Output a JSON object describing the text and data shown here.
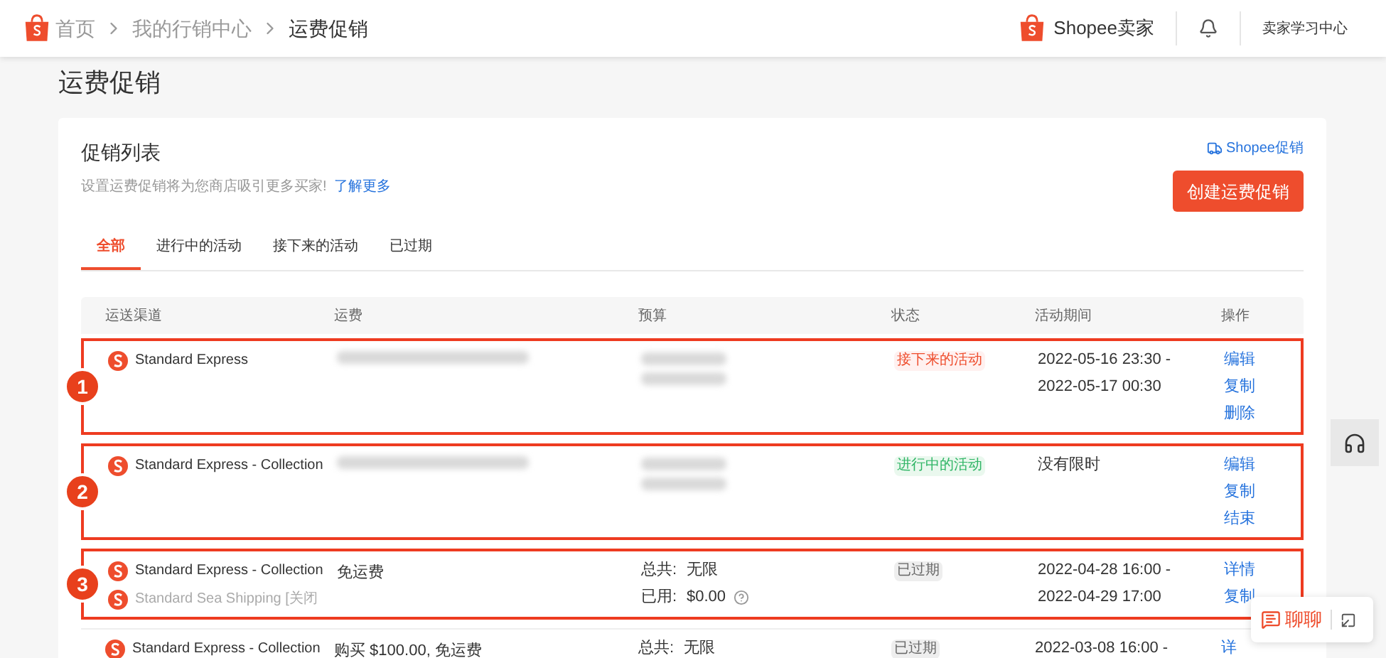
{
  "breadcrumb": [
    {
      "label": "首页",
      "current": false
    },
    {
      "label": "我的行销中心",
      "current": false
    },
    {
      "label": "运费促销",
      "current": true
    }
  ],
  "header": {
    "brand": "Shopee卖家",
    "learning_center": "卖家学习中心"
  },
  "page_title": "运费促销",
  "card": {
    "title": "促销列表",
    "description": "设置运费促销将为您商店吸引更多买家!",
    "learn_more": "了解更多",
    "shopee_link": "Shopee促销",
    "create_button": "创建运费促销"
  },
  "tabs": [
    {
      "label": "全部",
      "selected": true
    },
    {
      "label": "进行中的活动",
      "selected": false
    },
    {
      "label": "接下来的活动",
      "selected": false
    },
    {
      "label": "已过期",
      "selected": false
    }
  ],
  "table": {
    "columns": [
      "运送渠道",
      "运费",
      "预算",
      "状态",
      "活动期间",
      "操作"
    ],
    "rows": [
      {
        "annotation": "1",
        "channels": [
          {
            "name": "Standard Express",
            "disabled": false
          }
        ],
        "fee_redacted": true,
        "budget_redacted": true,
        "status": {
          "label": "接下来的活动",
          "kind": "upcoming"
        },
        "period": [
          "2022-05-16 23:30 -",
          "2022-05-17 00:30"
        ],
        "actions": [
          "编辑",
          "复制",
          "删除"
        ]
      },
      {
        "annotation": "2",
        "channels": [
          {
            "name": "Standard Express - Collection",
            "disabled": false
          }
        ],
        "fee_redacted": true,
        "budget_redacted": true,
        "status": {
          "label": "进行中的活动",
          "kind": "ongoing"
        },
        "period": [
          "没有限时"
        ],
        "actions": [
          "编辑",
          "复制",
          "结束"
        ]
      },
      {
        "annotation": "3",
        "channels": [
          {
            "name": "Standard Express - Collection",
            "disabled": false
          },
          {
            "name": "Standard Sea Shipping [关闭",
            "disabled": true
          }
        ],
        "fee": "免运费",
        "budget": [
          {
            "label": "总共:",
            "value": "无限"
          },
          {
            "label": "已用:",
            "value": "$0.00",
            "help": true
          }
        ],
        "status": {
          "label": "已过期",
          "kind": "expired"
        },
        "period": [
          "2022-04-28 16:00 -",
          "2022-04-29 17:00"
        ],
        "actions": [
          "详情",
          "复制"
        ]
      },
      {
        "channels": [
          {
            "name": "Standard Express - Collection",
            "disabled": false
          }
        ],
        "fee": "购买 $100.00, 免运费",
        "budget": [
          {
            "label": "总共:",
            "value": "无限"
          }
        ],
        "status": {
          "label": "已过期",
          "kind": "expired"
        },
        "period": [
          "2022-03-08 16:00 -"
        ],
        "actions": [
          "详"
        ]
      }
    ]
  },
  "chat": {
    "label": "聊聊"
  }
}
